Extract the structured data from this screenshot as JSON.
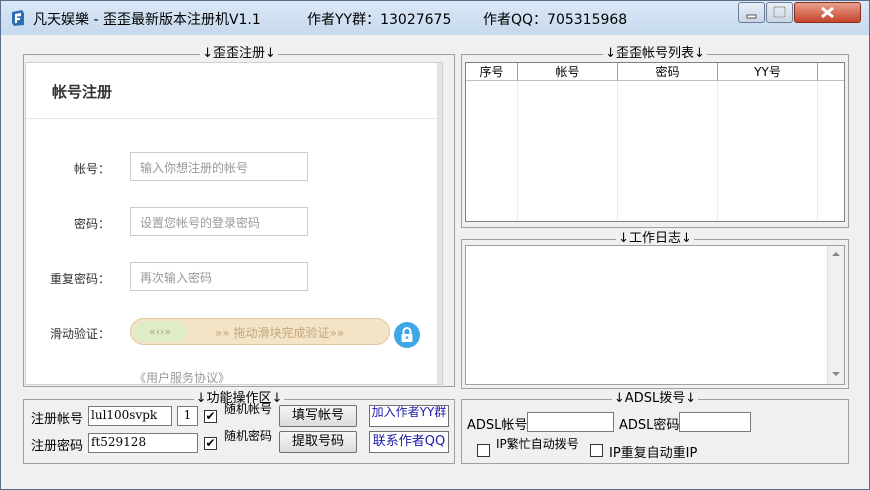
{
  "window": {
    "title": "凡天娱樂 - 歪歪最新版本注册机V1.1",
    "yy_group": "作者YY群：13027675",
    "qq": "作者QQ：705315968"
  },
  "left_group": {
    "label": "↓歪歪注册↓"
  },
  "web_form": {
    "heading": "帐号注册",
    "account_label": "帐号：",
    "account_placeholder": "输入你想注册的帐号",
    "password_label": "密码：",
    "password_placeholder": "设置您帐号的登录密码",
    "repeat_label": "重复密码：",
    "repeat_placeholder": "再次输入密码",
    "slider_label": "滑动验证：",
    "slider_text": "»» 拖动滑块完成验证»»",
    "agreement": "《用户服务协议》"
  },
  "account_list": {
    "label": "↓歪歪帐号列表↓",
    "columns": [
      "序号",
      "帐号",
      "密码",
      "YY号"
    ]
  },
  "work_log": {
    "label": "↓工作日志↓"
  },
  "ops": {
    "label": "↓功能操作区↓",
    "account_label": "注册帐号",
    "account_value": "lul100svpk",
    "count_value": "1",
    "random_account": "随机帐号",
    "fill_button": "填写帐号",
    "add_group_button": "加入作者YY群",
    "password_label": "注册密码",
    "password_value": "ft529128",
    "random_password": "随机密码",
    "fetch_button": "提取号码",
    "contact_button": "联系作者QQ"
  },
  "adsl": {
    "label": "↓ADSL拨号↓",
    "account_label": "ADSL帐号",
    "password_label": "ADSL密码",
    "auto_dial": "IP繁忙自动拨号",
    "repeat_ip": "IP重复自动重IP"
  }
}
